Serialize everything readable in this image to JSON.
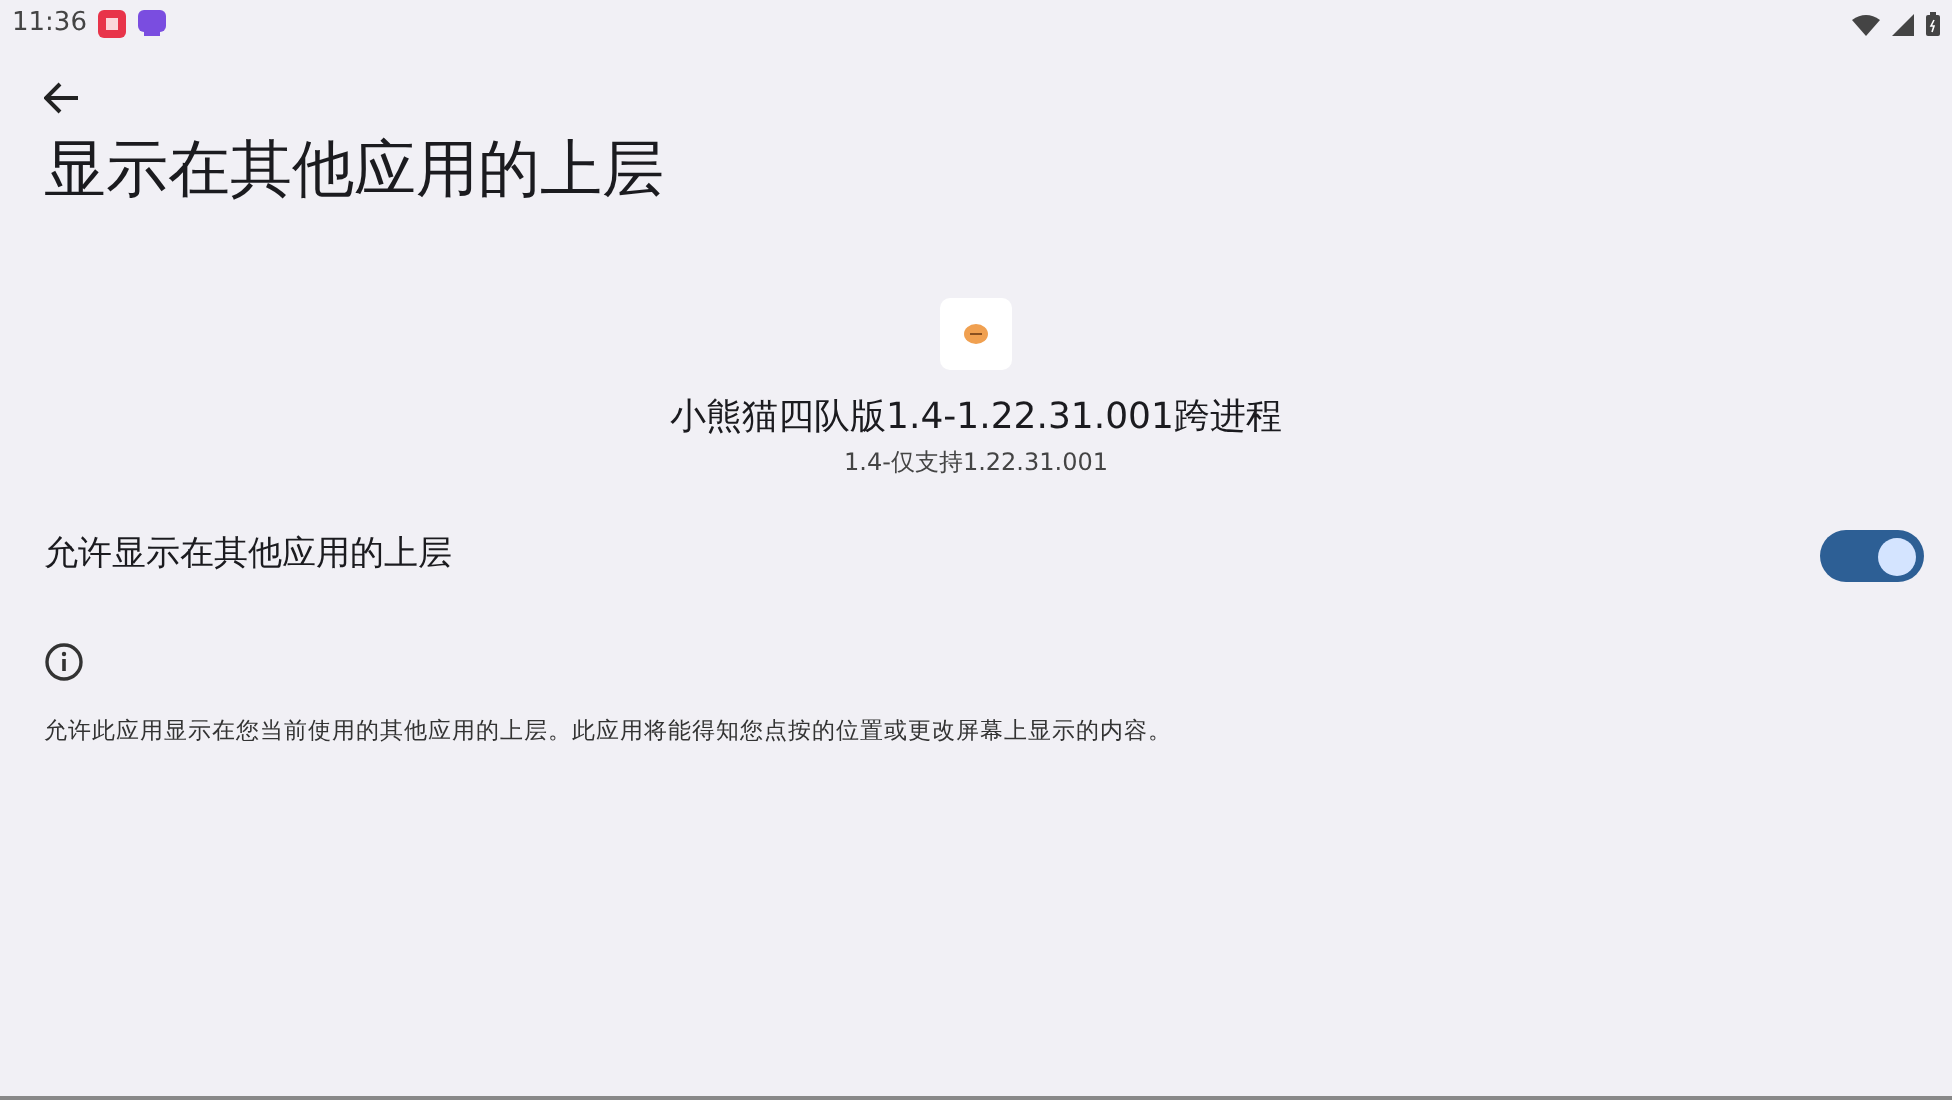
{
  "status_bar": {
    "time": "11:36"
  },
  "page": {
    "title": "显示在其他应用的上层"
  },
  "app": {
    "name": "小熊猫四队版1.4-1.22.31.001跨进程",
    "version": "1.4-仅支持1.22.31.001"
  },
  "setting": {
    "label": "允许显示在其他应用的上层",
    "on": true
  },
  "info": {
    "text": "允许此应用显示在您当前使用的其他应用的上层。此应用将能得知您点按的位置或更改屏幕上显示的内容。"
  }
}
